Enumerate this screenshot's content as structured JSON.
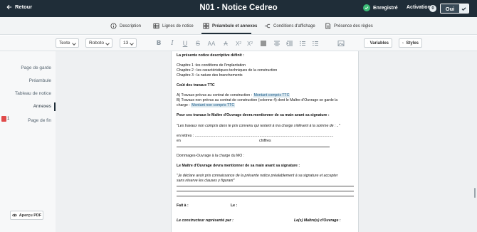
{
  "header": {
    "back_label": "Retour",
    "title": "N01 - Notice Cedreo",
    "saved_label": "Enregistré",
    "activation_label": "Activation",
    "activation_count": "0",
    "toggle_label": "Oui"
  },
  "tabs": [
    {
      "label": "Description"
    },
    {
      "label": "Lignes de notice"
    },
    {
      "label": "Préambule et annexes"
    },
    {
      "label": "Conditions d'affichage"
    },
    {
      "label": "Présence des règles"
    }
  ],
  "toolbar": {
    "style_select": "Texte",
    "font_select": "Roboto",
    "size_select": "13",
    "variables_label": "Variables",
    "styles_label": "Styles",
    "icons": [
      "bold-icon",
      "italic-icon",
      "underline-icon",
      "strikethrough-icon",
      "font-size-icon",
      "clear-format-icon",
      "superscript-icon",
      "subscript-icon",
      "align-icon",
      "align-center-icon",
      "indent-icon",
      "ordered-list-icon",
      "bullet-list-icon",
      "image-icon"
    ]
  },
  "sidebar": {
    "items": [
      {
        "label": "Page de garde"
      },
      {
        "label": "Préambule"
      },
      {
        "label": "Tableau de notice"
      },
      {
        "label": "Annexes"
      },
      {
        "label": "Page de fin"
      }
    ],
    "page_badge": "1",
    "preview_label": "Aperçu PDF"
  },
  "document": {
    "heading1": "La présente notice descriptive définit :",
    "chapter1": "Chapitre 1 :les conditions de l'implantation",
    "chapter2": "Chapitre 2 : les caractéristiques techniques de la construction",
    "chapter3": "Chapitre 3 : la nature des branchements",
    "cost_title": "Coût des travaux TTC",
    "cost_a_prefix": "A) Travaux prévus au contrat de construction : ",
    "cost_a_var": "Montant compris TTC",
    "cost_b_line1": "B) Travaux non prévus au contrat de construction (colonne 4) dont le Maître d'Ouvrage se garde la",
    "cost_b_prefix": "charge : ",
    "cost_b_var": "Montant non compris TTC",
    "sig1_title": "Pour ces travaux le Maître d'Ouvrage devra mentionner de sa main avant sa signature :",
    "sig1_quote": "\"Les travaux non compris dans le prix convenu qui restent à ma charge s'élèvent à la somme de : ..\"",
    "letters_label": "en lettres : .......................................................................................................................................",
    "en_label": "en",
    "chiffres_label": "chiffres",
    "do_label": "Dommages-Ouvrage à la charge du MO :",
    "sig2_title": "Le Maître d'Ouvrage devra mentionner de sa main avant sa signature :",
    "sig2_quote1": "\"Je déclare avoir pris connaissance de la présente notice préalablement à sa signature et accepter",
    "sig2_quote2": "sans réserve les clauses y figurant\"",
    "fait_label": "Fait à :",
    "le_label": "Le :",
    "constructeur_label": "Le constructeur représenté par :",
    "maitre_label": "Le(s) Maître(s) d'Ouvrage :"
  }
}
